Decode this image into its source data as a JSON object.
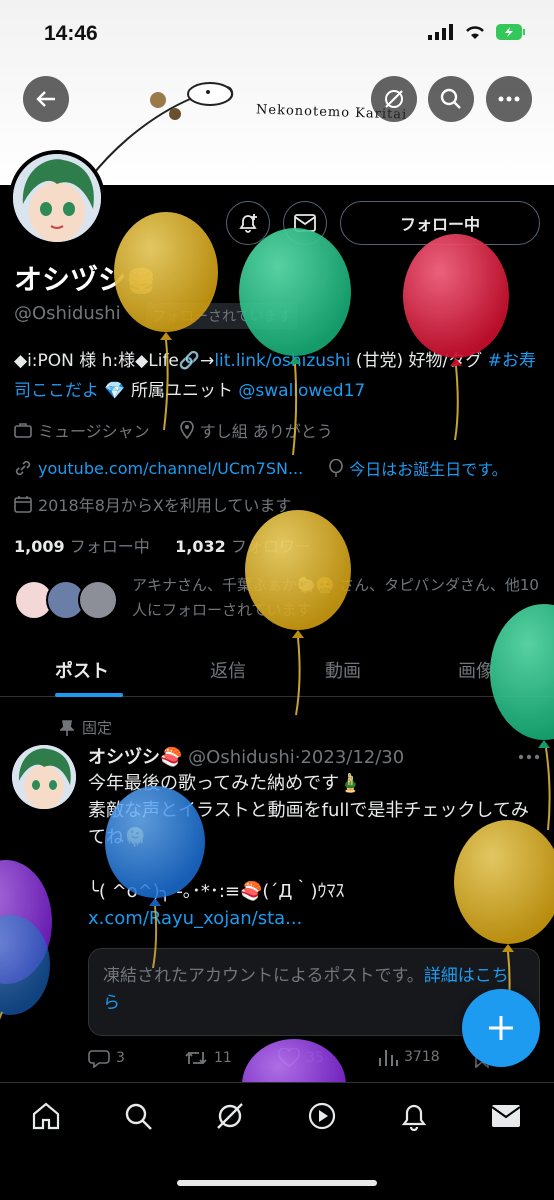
{
  "status_bar": {
    "time": "14:46"
  },
  "banner": {
    "text": "Nekonotemo Karitai"
  },
  "profile": {
    "name": "オシヅシ",
    "handle": "@Oshidushi",
    "follows_you": "フォローされています",
    "follow_button": "フォロー中",
    "bio_prefix": "◆i:PON 様 h:様◆Life🔗→",
    "bio_link": "lit.link/oshizushi",
    "bio_mid": " (甘党) 好物/タグ ",
    "bio_hashtag": "#お寿司ここだよ",
    "bio_mid2": " 💎 所属ユニット ",
    "bio_mention": "@swallowed17",
    "category": "ミュージシャン",
    "location": "すし組 ありがとう",
    "website": "youtube.com/channel/UCm7SN...",
    "birthday": "今日はお誕生日です。",
    "joined": "2018年8月からXを利用しています",
    "following_count": "1,009",
    "following_label": "フォロー中",
    "followers_count": "1,032",
    "followers_label": "フォロワー",
    "followed_by": "アキナさん、千葉ふぁか🐑🤮 さん、タピパンダさん、他10人にフォローされています"
  },
  "tabs": [
    "ポスト",
    "返信",
    "動画",
    "画像"
  ],
  "pinned_post": {
    "pinned_label": "固定",
    "author_name": "オシヅシ🍣",
    "author_handle": "@Oshidushi",
    "date": "2023/12/30",
    "line1": "今年最後の歌ってみた納めです🎍",
    "line2": "素敵な声とイラストと動画をfullで是非チェックしてみてね🫠",
    "line3": "╰( ^o^)╮ -｡･*･:≡🍣(´Д｀)ｳﾏｽ ",
    "link": "x.com/Rayu_xojan/sta...",
    "quote_text": "凍結されたアカウントによるポストです。",
    "quote_link": "詳細はこちら",
    "replies": "3",
    "reposts": "11",
    "likes": "35",
    "views": "3718"
  },
  "colors": {
    "accent": "#1d9bf0",
    "background": "#000000",
    "muted": "#71767b"
  }
}
